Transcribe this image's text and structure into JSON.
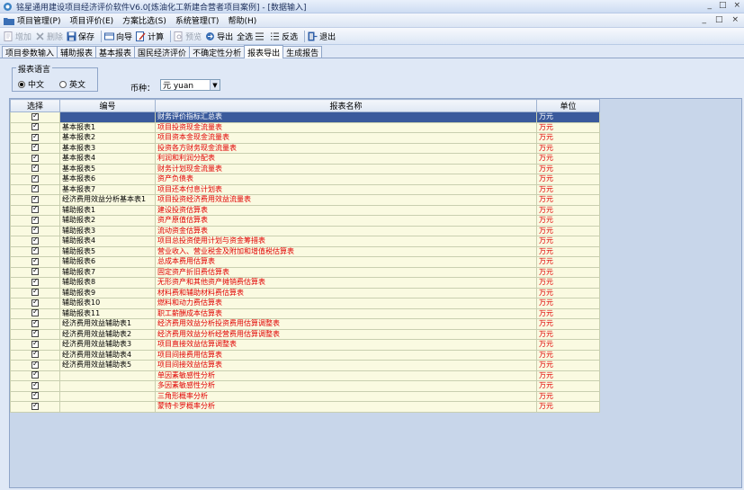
{
  "window": {
    "title": "铭星通用建设项目经济评价软件V6.0[炼油化工新建合营者项目案例] - [数据输入]",
    "controls": [
      "_",
      "□",
      "×"
    ],
    "mdi_controls": [
      "_",
      "□",
      "×"
    ]
  },
  "menu": [
    {
      "label": "项目管理(P)",
      "icon": "folder-icon"
    },
    {
      "label": "项目评价(E)"
    },
    {
      "label": "方案比选(S)"
    },
    {
      "label": "系统管理(T)"
    },
    {
      "label": "帮助(H)"
    }
  ],
  "toolbar": {
    "add": "增加",
    "delete": "删除",
    "save": "保存",
    "wizard": "向导",
    "calc": "计算",
    "preview": "预览",
    "export": "导出",
    "select_all": "全选",
    "invert": "反选",
    "exit": "退出"
  },
  "tabs": [
    "项目参数输入",
    "辅助报表",
    "基本报表",
    "国民经济评价",
    "不确定性分析",
    "报表导出",
    "生成报告"
  ],
  "active_tab": 5,
  "lang": {
    "legend": "报表语言",
    "chinese": "中文",
    "english": "英文"
  },
  "currency": {
    "label": "币种：",
    "value": "元 yuan"
  },
  "grid": {
    "headers": {
      "select": "选择",
      "code": "编号",
      "name": "报表名称",
      "unit": "单位"
    },
    "rows": [
      {
        "code": "",
        "name": "财务评价指标汇总表",
        "unit": "万元",
        "selected": true
      },
      {
        "code": "基本报表1",
        "name": "项目投资现金流量表",
        "unit": "万元"
      },
      {
        "code": "基本报表2",
        "name": "项目资本金现金流量表",
        "unit": "万元"
      },
      {
        "code": "基本报表3",
        "name": "投资各方财务现金流量表",
        "unit": "万元"
      },
      {
        "code": "基本报表4",
        "name": "利润和利润分配表",
        "unit": "万元"
      },
      {
        "code": "基本报表5",
        "name": "财务计划现金流量表",
        "unit": "万元"
      },
      {
        "code": "基本报表6",
        "name": "资产负债表",
        "unit": "万元"
      },
      {
        "code": "基本报表7",
        "name": "项目还本付息计划表",
        "unit": "万元"
      },
      {
        "code": "经济费用效益分析基本表1",
        "name": "项目投资经济费用效益流量表",
        "unit": "万元"
      },
      {
        "code": "辅助报表1",
        "name": "建设投资估算表",
        "unit": "万元"
      },
      {
        "code": "辅助报表2",
        "name": "资产原值估算表",
        "unit": "万元"
      },
      {
        "code": "辅助报表3",
        "name": "流动资金估算表",
        "unit": "万元"
      },
      {
        "code": "辅助报表4",
        "name": "项目总投资使用计划与资金筹措表",
        "unit": "万元"
      },
      {
        "code": "辅助报表5",
        "name": "营业收入、营业税金及附加和增值税估算表",
        "unit": "万元"
      },
      {
        "code": "辅助报表6",
        "name": "总成本费用估算表",
        "unit": "万元"
      },
      {
        "code": "辅助报表7",
        "name": "固定资产折旧费估算表",
        "unit": "万元"
      },
      {
        "code": "辅助报表8",
        "name": "无形资产和其他资产摊销费估算表",
        "unit": "万元"
      },
      {
        "code": "辅助报表9",
        "name": "材料费和辅助材料费估算表",
        "unit": "万元"
      },
      {
        "code": "辅助报表10",
        "name": "燃料和动力费估算表",
        "unit": "万元"
      },
      {
        "code": "辅助报表11",
        "name": "职工薪酬成本估算表",
        "unit": "万元"
      },
      {
        "code": "经济费用效益辅助表1",
        "name": "经济费用效益分析投资费用估算调整表",
        "unit": "万元"
      },
      {
        "code": "经济费用效益辅助表2",
        "name": "经济费用效益分析经营费用估算调整表",
        "unit": "万元"
      },
      {
        "code": "经济费用效益辅助表3",
        "name": "项目直接效益估算调整表",
        "unit": "万元"
      },
      {
        "code": "经济费用效益辅助表4",
        "name": "项目间接费用估算表",
        "unit": "万元"
      },
      {
        "code": "经济费用效益辅助表5",
        "name": "项目间接效益估算表",
        "unit": "万元"
      },
      {
        "code": "",
        "name": "单因素敏感性分析",
        "unit": "万元"
      },
      {
        "code": "",
        "name": "多因素敏感性分析",
        "unit": "万元"
      },
      {
        "code": "",
        "name": "三角形概率分析",
        "unit": "万元"
      },
      {
        "code": "",
        "name": "蒙特卡罗概率分析",
        "unit": "万元"
      }
    ]
  },
  "colors": {
    "selected_row": "#3a5a9c",
    "row_bg": "#fafae1",
    "name_text": "#e00000"
  }
}
